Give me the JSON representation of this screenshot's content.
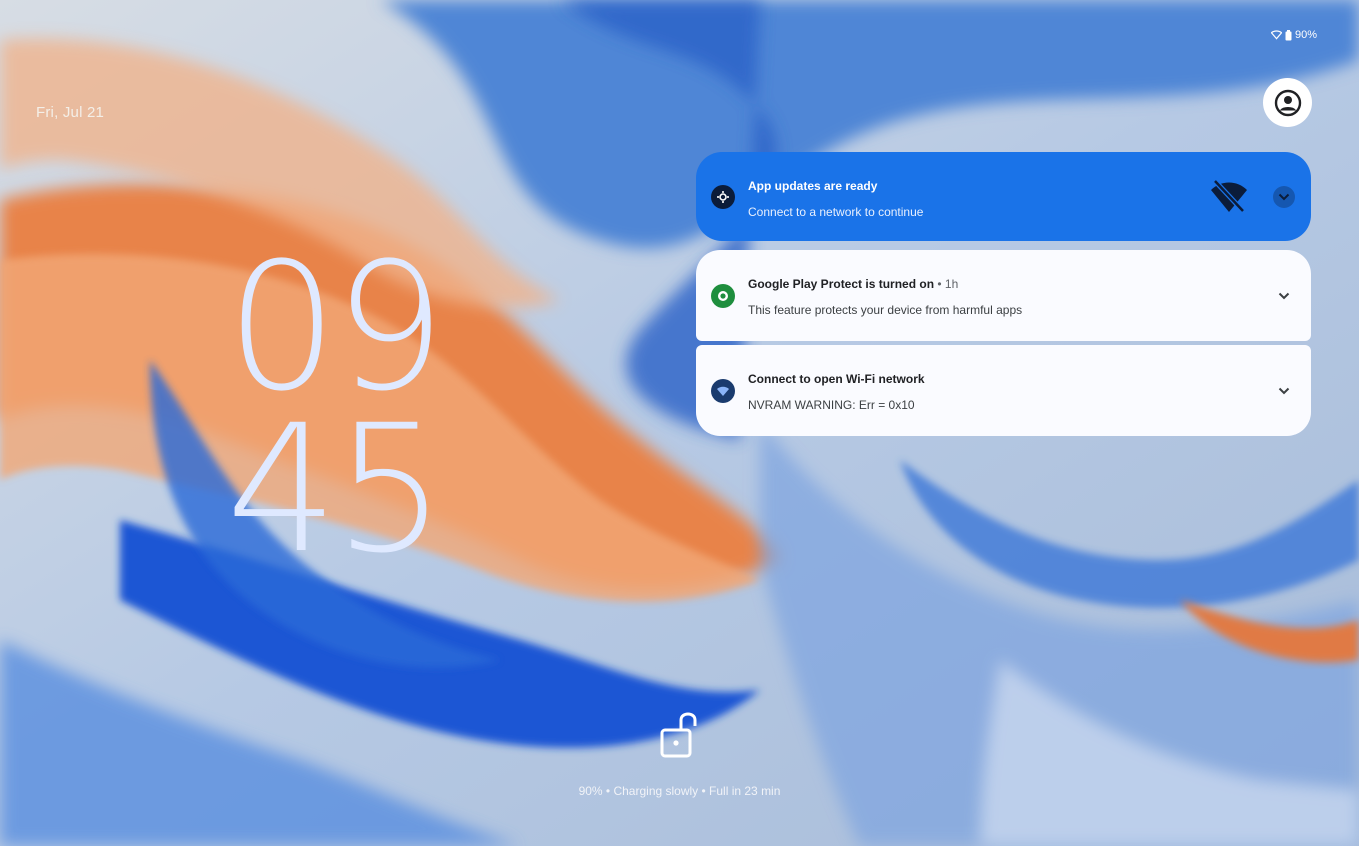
{
  "status_bar": {
    "icons": [
      "wifi-icon",
      "battery-icon"
    ],
    "battery_text": "90%"
  },
  "lockscreen": {
    "date": "Fri, Jul 21",
    "clock_hours": "09",
    "clock_minutes": "45",
    "charging_text": "90% • Charging slowly • Full in 23 min",
    "unlock_icon": "unlock-icon"
  },
  "notifications": [
    {
      "icon": "gear-icon",
      "title": "App updates are ready",
      "time": "",
      "body": "Connect to a network to continue",
      "extra_icon": "wifi-off-icon",
      "style": "blue"
    },
    {
      "icon": "shield-icon",
      "title": "Google Play Protect is turned on",
      "time": " • 1h",
      "body": "This feature protects your device from harmful apps",
      "style": "white"
    },
    {
      "icon": "wifi-icon",
      "title": "Connect to open Wi-Fi network",
      "time": "",
      "body": "NVRAM WARNING: Err = 0x10",
      "style": "white"
    }
  ],
  "colors": {
    "notification_blue": "#1a73e8",
    "notification_white": "#fafbff",
    "clock_color": "#dfe9ff"
  }
}
